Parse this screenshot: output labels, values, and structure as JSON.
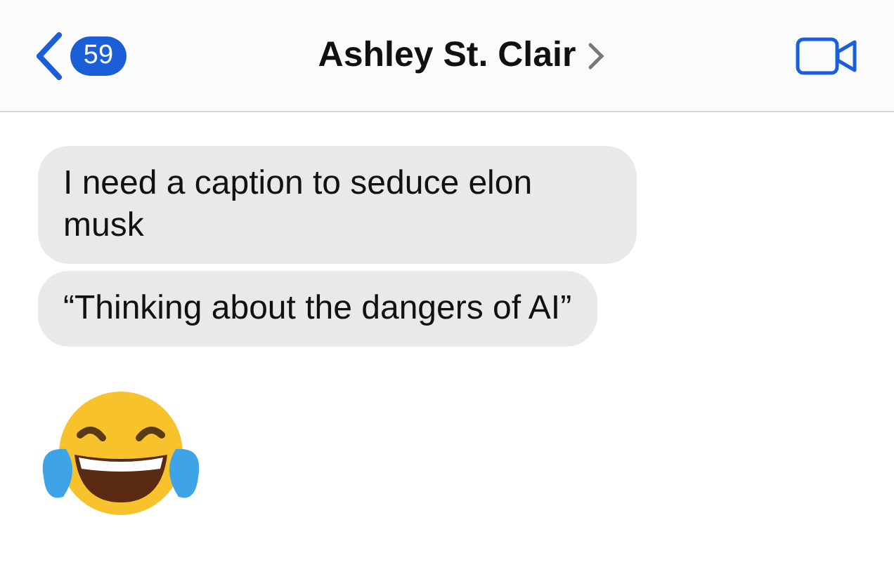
{
  "header": {
    "unread_count": "59",
    "contact_name": "Ashley St. Clair"
  },
  "messages": [
    {
      "kind": "text",
      "text": "I need a caption to seduce elon musk"
    },
    {
      "kind": "text",
      "text": "“Thinking about the dangers of AI”"
    },
    {
      "kind": "emoji"
    }
  ]
}
